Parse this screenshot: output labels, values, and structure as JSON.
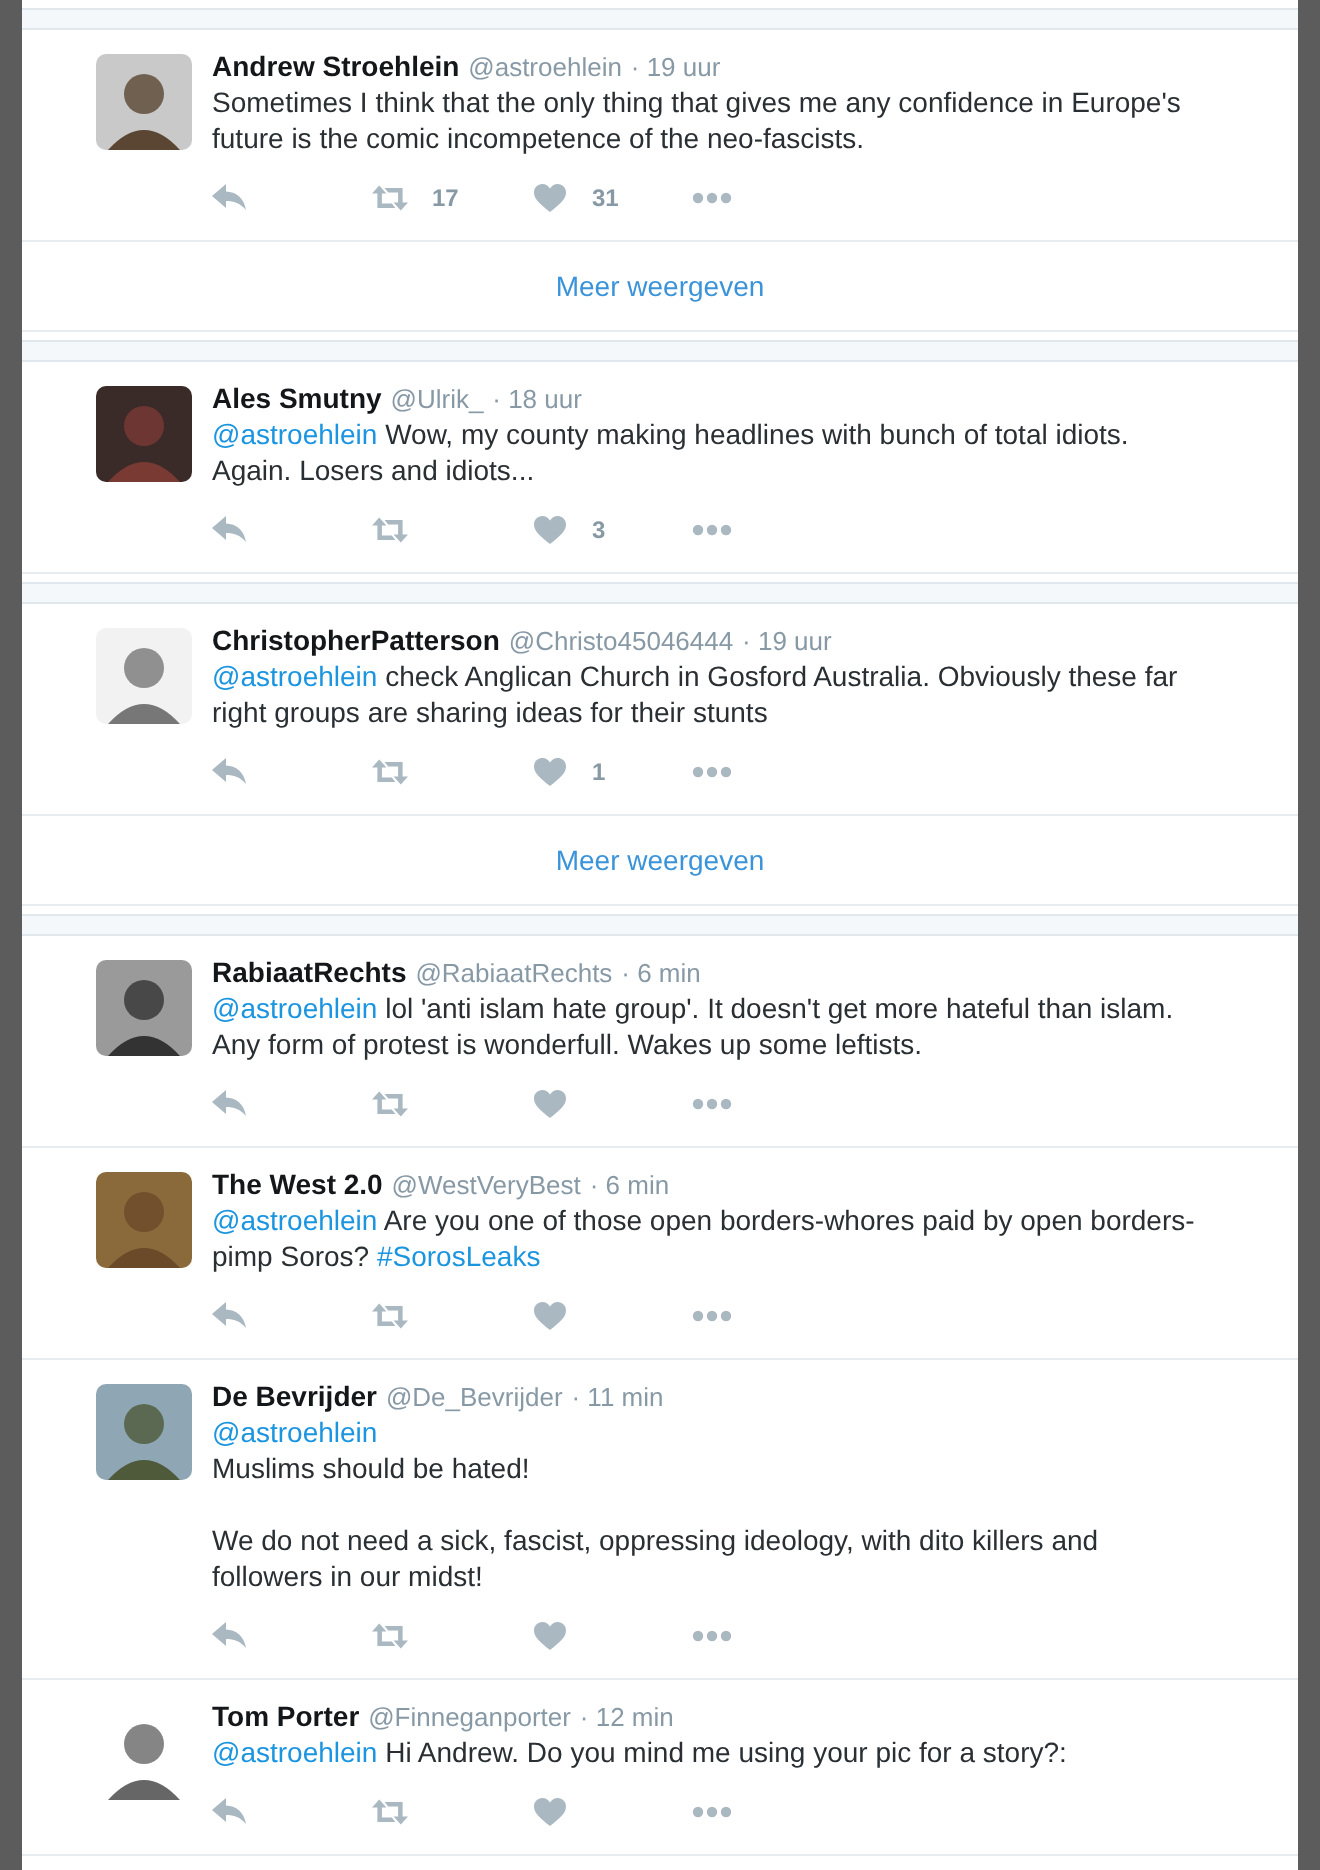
{
  "groups": [
    {
      "tweets": [
        {
          "name": "Andrew Stroehlein",
          "handle": "@astroehlein",
          "time": "· 19 uur",
          "text": [
            {
              "kind": "text",
              "text": "Sometimes I think that the only thing that gives me any confidence in Europe's future is the comic incompetence of the neo-fascists."
            }
          ],
          "retweets": "17",
          "likes": "31"
        }
      ],
      "more_link": "Meer weergeven"
    },
    {
      "tweets": [
        {
          "name": "Ales Smutny",
          "handle": "@Ulrik_",
          "time": "· 18 uur",
          "text": [
            {
              "kind": "mention",
              "text": "@astroehlein"
            },
            {
              "kind": "text",
              "text": " Wow, my county making headlines with bunch of total idiots. Again. Losers and idiots..."
            }
          ],
          "likes": "3"
        }
      ]
    },
    {
      "tweets": [
        {
          "name": "ChristopherPatterson",
          "handle": "@Christo45046444",
          "time": "· 19 uur",
          "text": [
            {
              "kind": "mention",
              "text": "@astroehlein"
            },
            {
              "kind": "text",
              "text": " check Anglican Church in Gosford Australia. Obviously these far right groups are sharing ideas for their stunts"
            }
          ],
          "likes": "1"
        }
      ],
      "more_link": "Meer weergeven"
    },
    {
      "tweets": [
        {
          "name": "RabiaatRechts",
          "handle": "@RabiaatRechts",
          "time": "· 6 min",
          "text": [
            {
              "kind": "mention",
              "text": "@astroehlein"
            },
            {
              "kind": "text",
              "text": " lol 'anti islam hate group'. It doesn't get more hateful than islam. Any form of protest is wonderfull. Wakes up some leftists."
            }
          ]
        },
        {
          "name": "The West 2.0",
          "handle": "@WestVeryBest",
          "time": "· 6 min",
          "text": [
            {
              "kind": "mention",
              "text": "@astroehlein"
            },
            {
              "kind": "text",
              "text": " Are you one of those open borders-whores paid by open borders-pimp Soros? "
            },
            {
              "kind": "hashtag",
              "text": "#SorosLeaks"
            }
          ]
        },
        {
          "name": "De Bevrijder",
          "handle": "@De_Bevrijder",
          "time": "· 11 min",
          "text": [
            {
              "kind": "mention",
              "text": "@astroehlein"
            },
            {
              "kind": "text",
              "text": "\nMuslims should be hated!\n\nWe do not need a sick, fascist, oppressing ideology, with dito killers and followers in our midst!"
            }
          ]
        },
        {
          "name": "Tom Porter",
          "handle": "@Finneganporter",
          "time": "· 12 min",
          "text": [
            {
              "kind": "mention",
              "text": "@astroehlein"
            },
            {
              "kind": "text",
              "text": " Hi Andrew. Do you mind me using your pic for a story?:"
            }
          ]
        }
      ]
    }
  ]
}
